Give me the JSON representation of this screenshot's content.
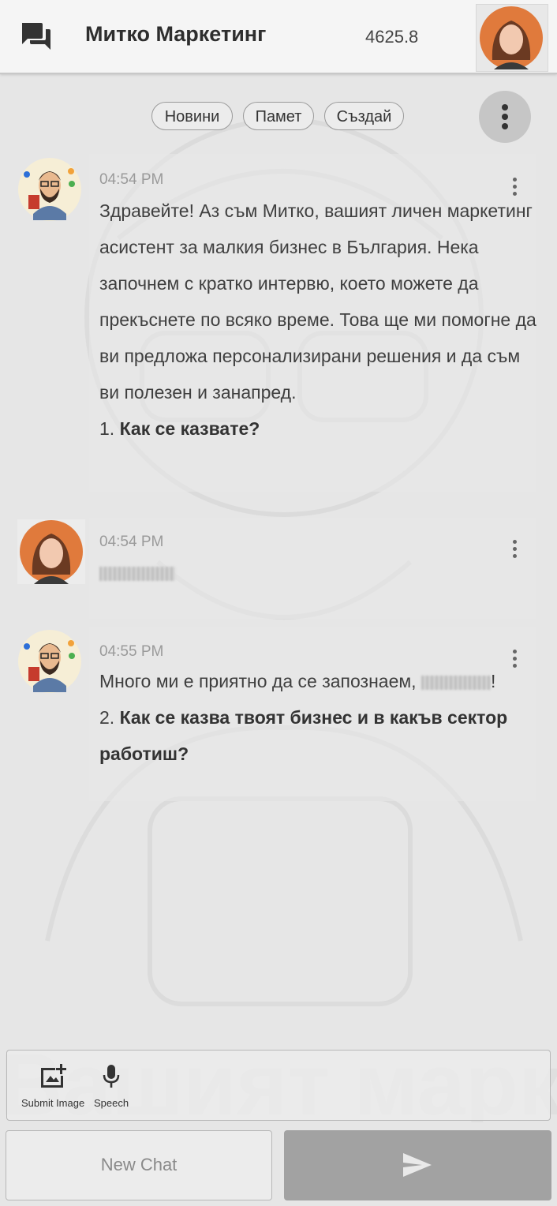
{
  "header": {
    "title": "Митко Маркетинг",
    "credits": "4625.8",
    "chat_icon": "chat-bubbles-icon",
    "avatar": "user-avatar"
  },
  "chips": {
    "news": "Новини",
    "memory": "Памет",
    "create": "Създай"
  },
  "messages": [
    {
      "sender": "assistant",
      "time": "04:54 PM",
      "text": "Здравейте! Аз съм Митко, вашият личен маркетинг асистент за малкия бизнес в България. Нека започнем с кратко интервю, което можете да прекъснете по всяко време. Това ще ми помогне да ви предложа персонализирани решения и да съм ви полезен и занапред.",
      "question_num": "1.",
      "question": "Как се казвате?"
    },
    {
      "sender": "user",
      "time": "04:54 PM",
      "text": ""
    },
    {
      "sender": "assistant",
      "time": "04:55 PM",
      "text_before": "Много ми е приятно да се запознаем,",
      "text_after": "!",
      "question_num": "2.",
      "question": "Как се казва твоят бизнес и в какъв сектор работиш?"
    }
  ],
  "tools": {
    "submit_image": "Submit Image",
    "speech": "Speech"
  },
  "buttons": {
    "new_chat": "New Chat",
    "send_icon": "send-icon"
  },
  "colors": {
    "background": "#e6e6e6",
    "header": "#f5f5f5",
    "send_button": "#a2a2a2",
    "user_avatar_bg": "#e07a3c"
  }
}
